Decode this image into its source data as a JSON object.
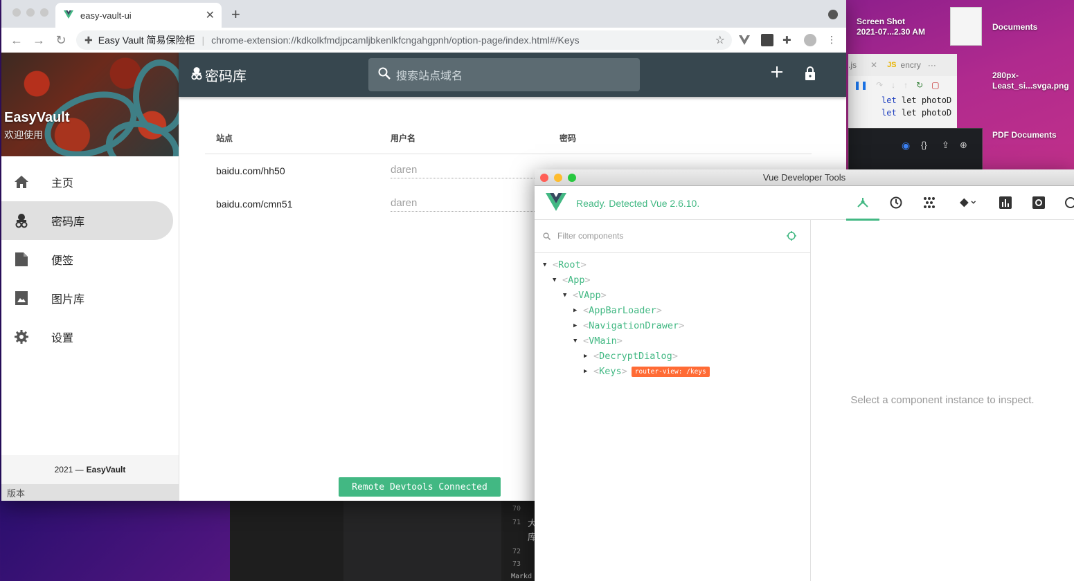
{
  "desktop": {
    "items": [
      {
        "label_line1": "Screen Shot",
        "label_line2": "2021-07...2.30 AM"
      },
      {
        "label_line1": "Documents",
        "label_line2": ""
      },
      {
        "label_line1": "280px-",
        "label_line2": "Least_si...svga.png"
      },
      {
        "label_line1": "PDF Documents",
        "label_line2": ""
      }
    ]
  },
  "bg_editor": {
    "tab1": ".js",
    "tab2": "encry",
    "code_lines": [
      "let photoD",
      "let photoD"
    ],
    "line_numbers": [
      "70",
      "71",
      "72",
      "73"
    ],
    "snippet1": "大",
    "snippet2": "库",
    "status": "Markd"
  },
  "browser": {
    "tab_title": "easy-vault-ui",
    "site_name": "Easy Vault 简易保险柜",
    "url": "chrome-extension://kdkolkfmdjpcamljbkenlkfcngahgpnh/option-page/index.html#/Keys"
  },
  "app": {
    "brand": "EasyVault",
    "welcome": "欢迎使用",
    "nav": [
      {
        "label": "主页"
      },
      {
        "label": "密码库"
      },
      {
        "label": "便签"
      },
      {
        "label": "图片库"
      },
      {
        "label": "设置"
      }
    ],
    "footer_year": "2021 —",
    "footer_brand": "EasyVault",
    "version_label": "版本",
    "appbar_title": "密码库",
    "search_placeholder": "搜索站点域名",
    "columns": [
      "站点",
      "用户名",
      "密码"
    ],
    "rows": [
      {
        "site": "baidu.com/hh50",
        "username": "daren"
      },
      {
        "site": "baidu.com/cmn51",
        "username": "daren"
      }
    ],
    "snackbar": "Remote Devtools Connected"
  },
  "devtools": {
    "window_title": "Vue Developer Tools",
    "status": "Ready. Detected Vue 2.6.10.",
    "filter_placeholder": "Filter components",
    "tree": [
      {
        "name": "Root",
        "expanded": true
      },
      {
        "name": "App",
        "expanded": true
      },
      {
        "name": "VApp",
        "expanded": true
      },
      {
        "name": "AppBarLoader",
        "expanded": false
      },
      {
        "name": "NavigationDrawer",
        "expanded": false
      },
      {
        "name": "VMain",
        "expanded": true
      },
      {
        "name": "DecryptDialog",
        "expanded": false
      },
      {
        "name": "Keys",
        "expanded": false,
        "badge": "router-view: /keys"
      }
    ],
    "inspect_hint": "Select a component instance to inspect."
  },
  "colors": {
    "vue_green": "#42b883",
    "appbar": "#37474f",
    "badge": "#ff6b35"
  }
}
